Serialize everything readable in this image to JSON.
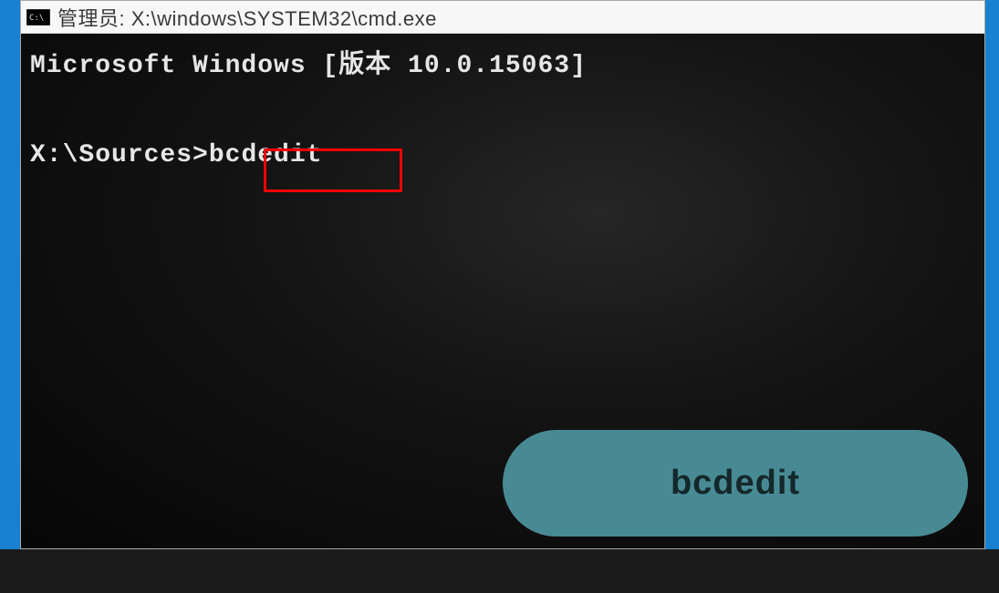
{
  "window": {
    "title_prefix": "管理员:",
    "title_path": "X:\\windows\\SYSTEM32\\cmd.exe"
  },
  "console": {
    "line1": "Microsoft Windows [版本 10.0.15063]",
    "prompt": "X:\\Sources>",
    "command": "bcdedit"
  },
  "callout": {
    "label": "bcdedit"
  },
  "colors": {
    "highlight": "#f40000",
    "callout_bg": "#488a94",
    "desktop": "#1881d0"
  }
}
